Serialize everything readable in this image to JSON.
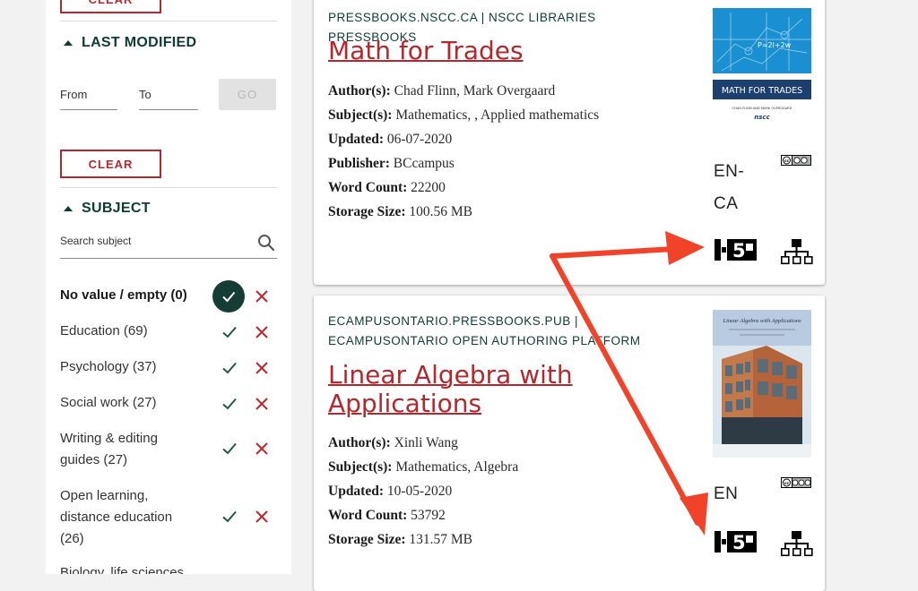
{
  "sidebar": {
    "clear_label": "CLEAR",
    "last_modified": {
      "title": "LAST MODIFIED",
      "from_placeholder": "From",
      "to_placeholder": "To",
      "go_label": "GO",
      "clear_label": "CLEAR"
    },
    "subject": {
      "title": "SUBJECT",
      "search_placeholder": "Search subject",
      "items": [
        {
          "label": "No value / empty (0)",
          "selected": true
        },
        {
          "label": "Education (69)"
        },
        {
          "label": "Psychology (37)"
        },
        {
          "label": "Social work (27)"
        },
        {
          "label": "Writing & editing guides (27)"
        },
        {
          "label": "Open learning, distance education (26)"
        },
        {
          "label": "Biology, life sciences"
        }
      ]
    }
  },
  "results": [
    {
      "source": "PRESSBOOKS.NSCC.CA | NSCC LIBRARIES PRESSBOOKS",
      "title": "Math for Trades",
      "authors_label": "Author(s):",
      "authors": "Chad Flinn, Mark Overgaard",
      "subjects_label": "Subject(s):",
      "subjects": "Mathematics, , Applied mathematics",
      "updated_label": "Updated:",
      "updated": "06-07-2020",
      "publisher_label": "Publisher:",
      "publisher": "BCcampus",
      "wordcount_label": "Word Count:",
      "wordcount": "22200",
      "storage_label": "Storage Size:",
      "storage": "100.56 MB",
      "language": "EN-CA",
      "cover": {
        "title": "MATH FOR TRADES",
        "authors": "CHAD FLINN AND MARK OVERGAARD",
        "org": "nscc",
        "formula": "P=2l+2w"
      }
    },
    {
      "source": "ECAMPUSONTARIO.PRESSBOOKS.PUB | ECAMPUSONTARIO OPEN AUTHORING PLATFORM",
      "title": "Linear Algebra with Applications",
      "authors_label": "Author(s):",
      "authors": "Xinli Wang",
      "subjects_label": "Subject(s):",
      "subjects": "Mathematics, Algebra",
      "updated_label": "Updated:",
      "updated": "10-05-2020",
      "wordcount_label": "Word Count:",
      "wordcount": "53792",
      "storage_label": "Storage Size:",
      "storage": "131.57 MB",
      "language": "EN",
      "cover": {
        "title": "Linear Algebra with Applications"
      }
    }
  ],
  "icons": {
    "check": "check-icon",
    "remove": "x-icon",
    "search": "search-icon",
    "h5p": "h5p-icon",
    "network": "network-icon",
    "license": "cc-license-icon"
  },
  "colors": {
    "accent": "#b3272d",
    "brand": "#0f3b33",
    "arrow": "#f0432a"
  }
}
